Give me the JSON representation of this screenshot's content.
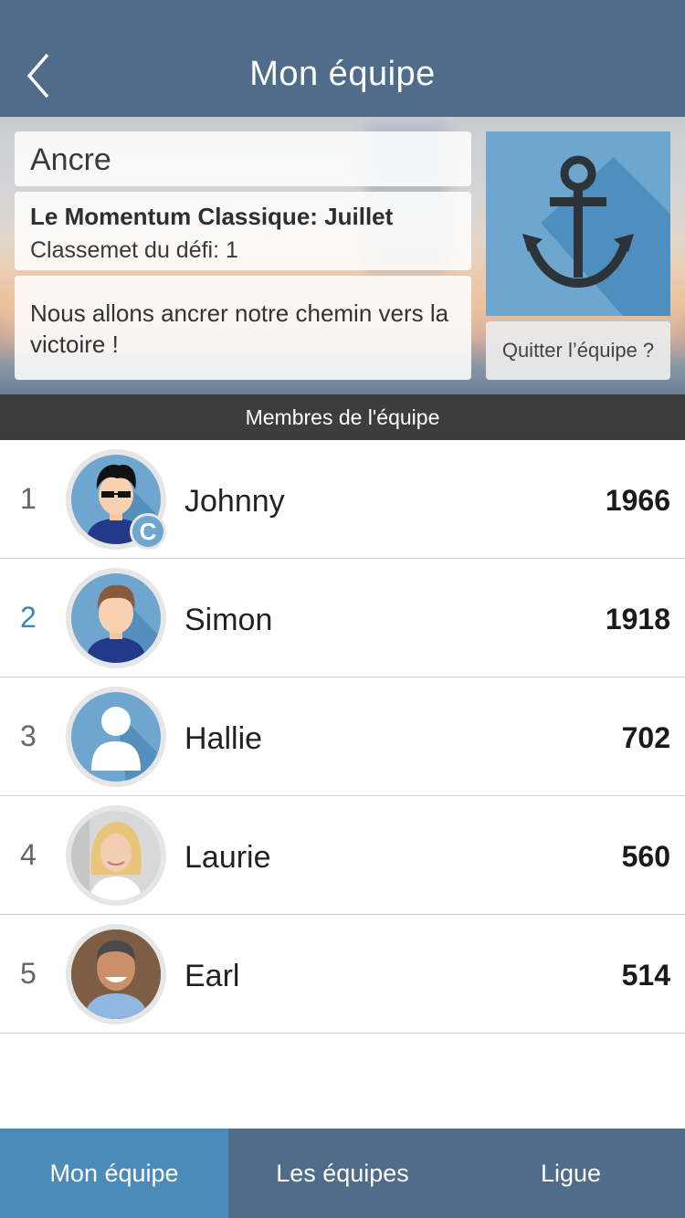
{
  "header": {
    "title": "Mon équipe",
    "back_icon": "chevron-left-icon"
  },
  "team": {
    "name": "Ancre",
    "challenge_name": "Le Momentum Classique: Juillet",
    "challenge_rank": "Classemet du défi: 1",
    "motto": "Nous allons ancrer notre chemin vers la victoire !",
    "logo_icon": "anchor-icon",
    "quit_label": "Quitter l’équipe ?"
  },
  "members_header": "Membres de l'équipe",
  "members": [
    {
      "rank": "1",
      "name": "Johnny",
      "score": "1966",
      "avatar": "avatar-sunglasses-man",
      "captain_badge": "C"
    },
    {
      "rank": "2",
      "name": "Simon",
      "score": "1918",
      "avatar": "avatar-man"
    },
    {
      "rank": "3",
      "name": "Hallie",
      "score": "702",
      "avatar": "avatar-placeholder"
    },
    {
      "rank": "4",
      "name": "Laurie",
      "score": "560",
      "avatar": "photo-woman"
    },
    {
      "rank": "5",
      "name": "Earl",
      "score": "514",
      "avatar": "photo-man"
    }
  ],
  "tabs": [
    {
      "label": "Mon équipe",
      "active": true
    },
    {
      "label": "Les équipes",
      "active": false
    },
    {
      "label": "Ligue",
      "active": false
    }
  ],
  "colors": {
    "header": "#4f6d8a",
    "tab_active": "#4a8bb9",
    "accent_blue": "#6ea6cf",
    "members_bar": "#3d3d3d",
    "rank_highlight": "#3d86b8"
  }
}
